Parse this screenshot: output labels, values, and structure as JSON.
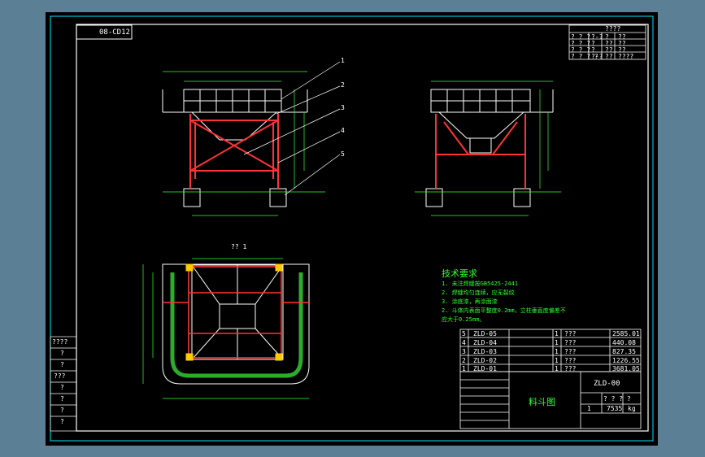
{
  "drawing_no": "08-CD12",
  "top_right_block": {
    "header": "????",
    "rows": [
      [
        "? ? ?",
        "?-?",
        "?",
        "??"
      ],
      [
        "? ? ?",
        "?",
        "??",
        "??"
      ],
      [
        "? ? ?",
        "?",
        "??",
        "??"
      ],
      [
        "? ? ? ?",
        "?-?",
        "??",
        "????"
      ]
    ]
  },
  "callouts": [
    "1",
    "2",
    "3",
    "4",
    "5"
  ],
  "plan_view_label": "?? 1",
  "tech": {
    "title": "技术要求",
    "line1": "1. 未注焊缝按GB5425-2441",
    "line2": "2. 焊缝均匀连续，应无裂纹",
    "line3": "3. 涂底漆，再涂面漆",
    "line4": "2. 斗体内表面平整度0.2mm，立柱垂直度偏差不",
    "line5": "应大于0.25mm。"
  },
  "parts": [
    {
      "no": "5",
      "code": "ZLD-05",
      "name": "",
      "qty": "1",
      "mat": "???",
      "weight": "2585.01"
    },
    {
      "no": "4",
      "code": "ZLD-04",
      "name": "",
      "qty": "1",
      "mat": "???",
      "weight": "440.08"
    },
    {
      "no": "3",
      "code": "ZLD-03",
      "name": "",
      "qty": "1",
      "mat": "???",
      "weight": "827.35"
    },
    {
      "no": "2",
      "code": "ZLD-02",
      "name": "",
      "qty": "1",
      "mat": "???",
      "weight": "1226.55"
    },
    {
      "no": "1",
      "code": "ZLD-01",
      "name": "",
      "qty": "1",
      "mat": "???",
      "weight": "3681.05"
    }
  ],
  "title_block": {
    "drawing_title": "料斗图",
    "code": "ZLD-00",
    "scale_marks": "? ? ? ?",
    "total_weight": "7535",
    "unit": "kg",
    "sheet": "1"
  },
  "left_side_table": {
    "rows": [
      "????",
      "?",
      "?",
      "???",
      "?",
      "?",
      "?",
      "?"
    ]
  },
  "colors": {
    "background": "#5b7f95",
    "sheet": "#000000",
    "linework": "#ffffff",
    "structure": "#ff3333",
    "dimension": "#33ff33",
    "frame_cyan": "#00e5ff"
  }
}
